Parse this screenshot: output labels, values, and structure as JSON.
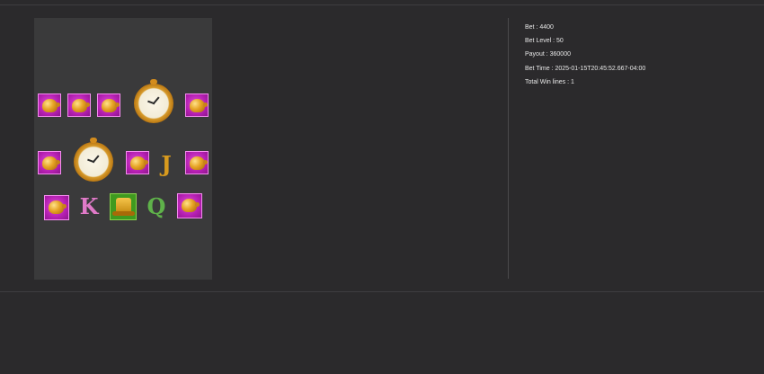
{
  "info": {
    "bet": "Bet : 4400",
    "bet_level": "Bet Level : 50",
    "payout": "Payout : 360000",
    "bet_time": "Bet Time : 2025-01-15T20:45:52.667-04:00",
    "total_win_lines": "Total Win lines : 1"
  },
  "board": {
    "letters": {
      "j": "J",
      "k": "K",
      "q": "Q"
    },
    "colors": {
      "tile": "#b51fb2",
      "bell": "#e6a324",
      "clock_face": "#f2ecd8",
      "hat_tile": "#3f9a1f",
      "j": "#d89a1e",
      "k": "#e07ac8",
      "q": "#5fb24a"
    }
  }
}
